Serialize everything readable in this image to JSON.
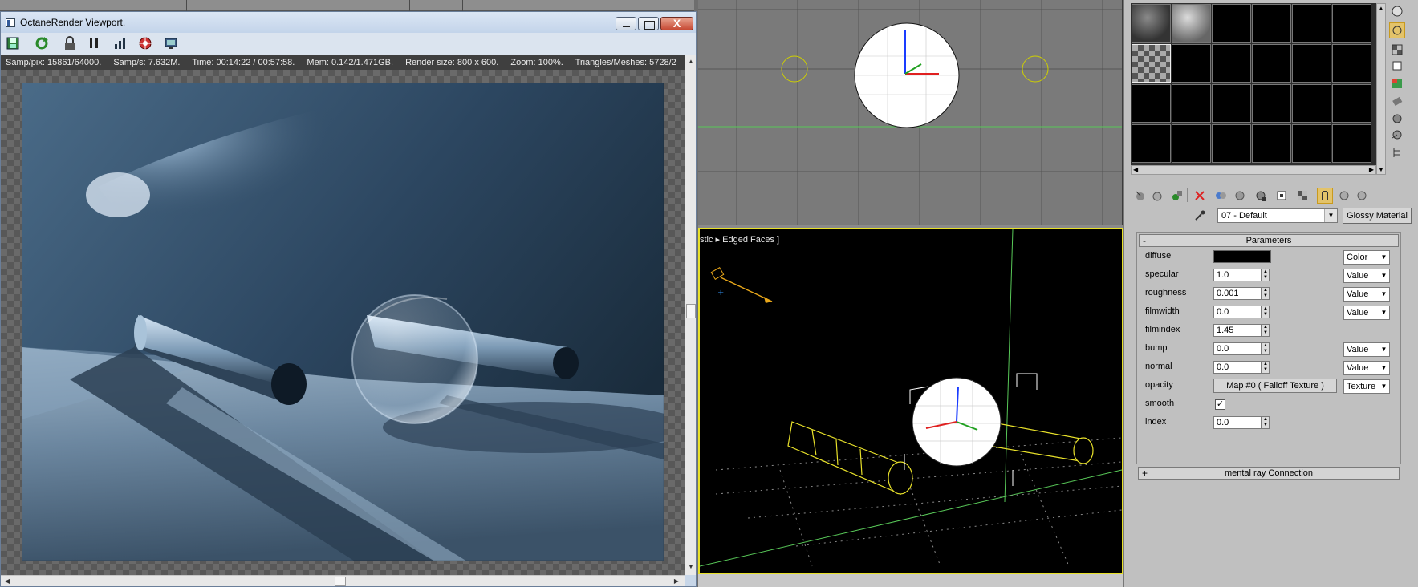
{
  "octane_window": {
    "title": "OctaneRender Viewport.",
    "toolbar_icons": [
      "save-render-icon",
      "restart-render-icon",
      "lock-icon",
      "pause-icon",
      "stats-icon",
      "focus-picker-icon",
      "settings-icon"
    ],
    "status": {
      "samp_pix": "Samp/pix: 15861/64000.",
      "samp_s": "Samp/s: 7.632M.",
      "time": "Time: 00:14:22 / 00:57:58.",
      "mem": "Mem: 0.142/1.471GB.",
      "render_size": "Render size: 800 x 600.",
      "zoom": "Zoom: 100%.",
      "triangles": "Triangles/Meshes: 5728/2"
    },
    "close_glyph": "X"
  },
  "viewports": {
    "perspective_label": "stic ▸ Edged Faces ]"
  },
  "material_editor": {
    "material_name": "07 - Default",
    "material_type": "Glossy Material",
    "rollout_title": "Parameters",
    "rollout_collapse": "-",
    "params": [
      {
        "label": "diffuse",
        "kind": "color",
        "mode": "Color"
      },
      {
        "label": "specular",
        "kind": "spin",
        "value": "1.0",
        "mode": "Value"
      },
      {
        "label": "roughness",
        "kind": "spin",
        "value": "0.001",
        "mode": "Value"
      },
      {
        "label": "filmwidth",
        "kind": "spin",
        "value": "0.0",
        "mode": "Value"
      },
      {
        "label": "filmindex",
        "kind": "spin",
        "value": "1.45",
        "mode": ""
      },
      {
        "label": "bump",
        "kind": "spin",
        "value": "0.0",
        "mode": "Value"
      },
      {
        "label": "normal",
        "kind": "spin",
        "value": "0.0",
        "mode": "Value"
      },
      {
        "label": "opacity",
        "kind": "map",
        "value": "Map #0  ( Falloff Texture )",
        "mode": "Texture"
      },
      {
        "label": "smooth",
        "kind": "check",
        "value": "✓",
        "mode": ""
      },
      {
        "label": "index",
        "kind": "spin",
        "value": "0.0",
        "mode": ""
      }
    ],
    "mr_rollout": {
      "title": "mental ray Connection",
      "expand": "+"
    }
  }
}
